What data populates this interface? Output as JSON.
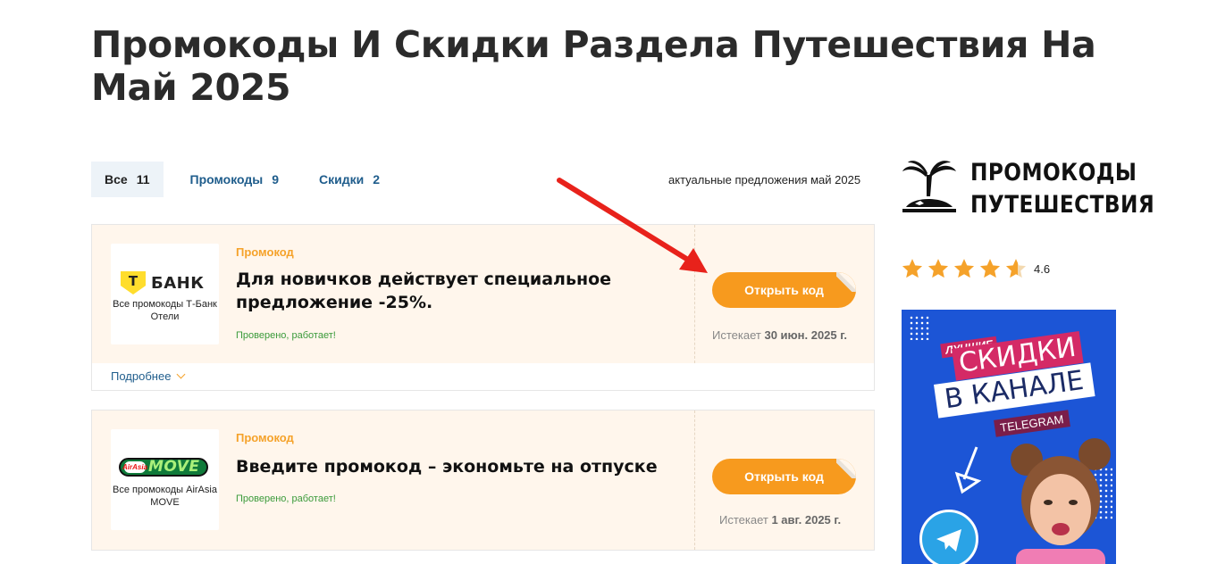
{
  "page": {
    "title": "Промокоды И Скидки Раздела Путешествия На Май 2025"
  },
  "tabs": [
    {
      "label": "Все",
      "count": "11",
      "active": true
    },
    {
      "label": "Промокоды",
      "count": "9",
      "active": false
    },
    {
      "label": "Скидки",
      "count": "2",
      "active": false
    }
  ],
  "actual_note": "актуальные предложения май 2025",
  "offers": [
    {
      "logo_text": "БАНК",
      "logo_shield_letter": "Т",
      "store_caption": "Все промокоды Т-Банк Отели",
      "type_label": "Промокод",
      "title": "Для новичков действует специальное предложение -25%.",
      "verified": "Проверено, работает!",
      "button_label": "Открыть код",
      "expires_prefix": "Истекает",
      "expires_date": "30 июн. 2025 г.",
      "more_label": "Подробнее"
    },
    {
      "logo_text": "MOVE",
      "logo_badge": "AirAsia",
      "store_caption": "Все промокоды AirAsia MOVE",
      "type_label": "Промокод",
      "title": "Введите промокод – экономьте на отпуске",
      "verified": "Проверено, работает!",
      "button_label": "Открыть код",
      "expires_prefix": "Истекает",
      "expires_date": "1 авг. 2025 г."
    }
  ],
  "sidebar": {
    "brand_line1": "ПРОМОКОДЫ",
    "brand_line2": "ПУТЕШЕСТВИЯ",
    "brand_icon": "palm-island-icon",
    "rating": 4.6,
    "rating_label": "4.6",
    "star_color": "#f5a22a",
    "banner": {
      "line1": "ЛУЧШИЕ",
      "line2": "СКИДКИ",
      "line3": "В КАНАЛЕ",
      "line4": "TELEGRAM",
      "background": "#1c55d6"
    }
  },
  "colors": {
    "accent_orange": "#f79a1e",
    "link_blue": "#1f5d8c",
    "card_bg": "#fff6ec",
    "verified_green": "#3a9a3a",
    "arrow_red": "#e8221b"
  }
}
